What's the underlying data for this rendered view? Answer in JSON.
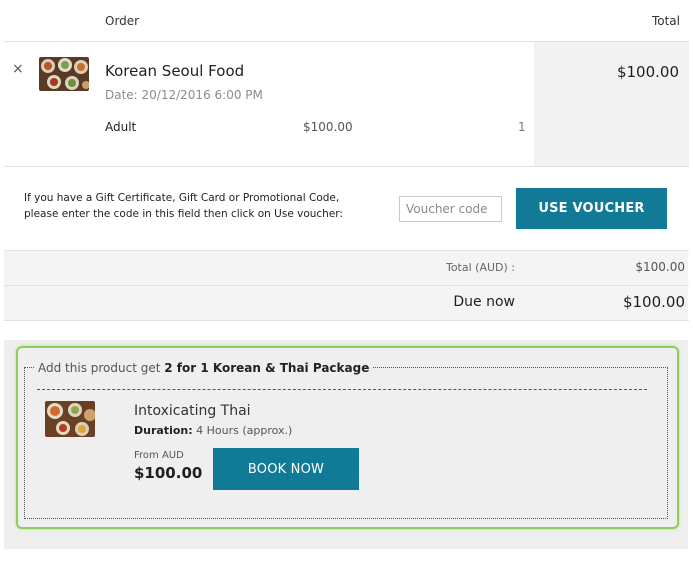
{
  "cart": {
    "header": {
      "order_label": "Order",
      "total_label": "Total"
    },
    "item": {
      "remove_symbol": "×",
      "image_icon": "food-photo",
      "name": "Korean Seoul Food",
      "date": "Date: 20/12/2016 6:00 PM",
      "total": "$100.00",
      "tickets": [
        {
          "type": "Adult",
          "price": "$100.00",
          "quantity": "1"
        }
      ]
    }
  },
  "voucher": {
    "instructions_line1": "If you have a Gift Certificate, Gift Card or Promotional Code,",
    "instructions_line2": "please enter the code in this field then click on Use voucher:",
    "input_placeholder": "Voucher code",
    "input_value": "",
    "button_label": "USE VOUCHER"
  },
  "totals": {
    "total_label": "Total (AUD) :",
    "total_value": "$100.00",
    "due_label": "Due now",
    "due_value": "$100.00"
  },
  "upsell": {
    "legend_prefix": "Add this product get",
    "legend_offer": "2 for 1 Korean & Thai Package",
    "product": {
      "image_icon": "food-photo",
      "name": "Intoxicating Thai",
      "duration_label": "Duration:",
      "duration_value": "4 Hours (approx.)",
      "from_label": "From AUD",
      "price": "$100.00",
      "button_label": "BOOK NOW"
    }
  },
  "colors": {
    "accent_button": "#117a96",
    "upsell_border": "#8fce5a"
  }
}
